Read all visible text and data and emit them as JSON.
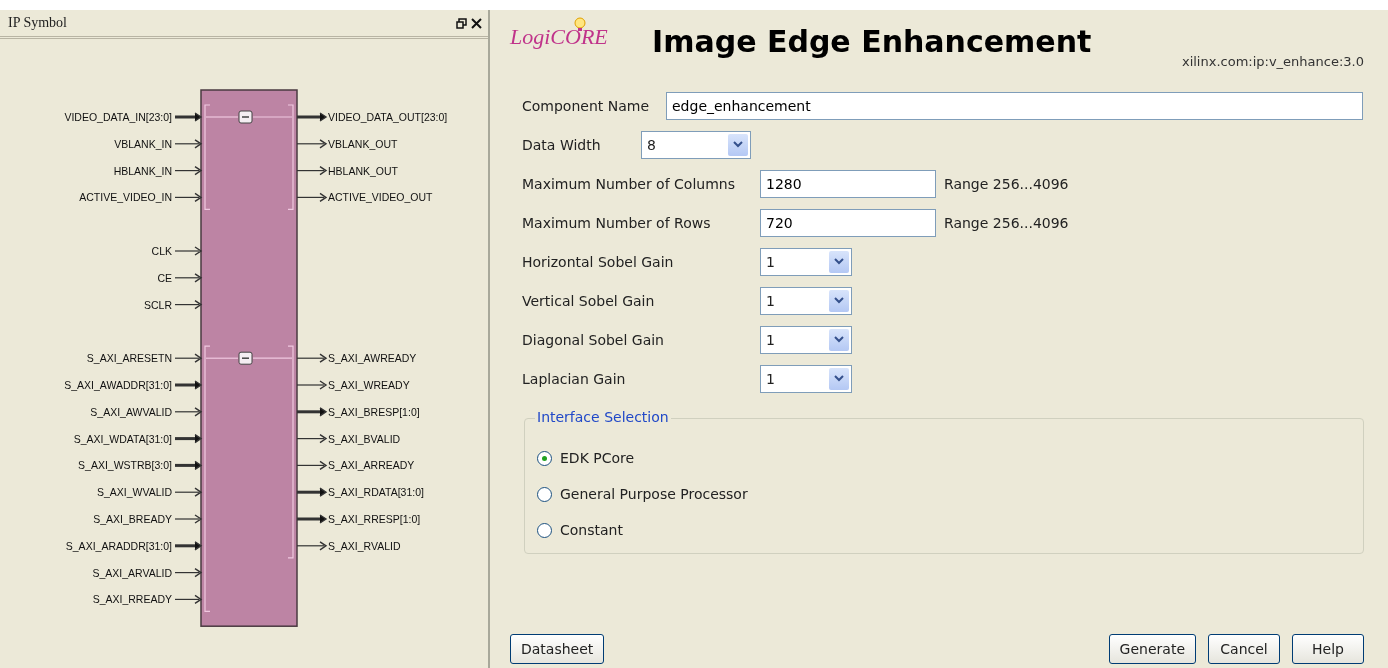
{
  "symbol_panel": {
    "title": "IP Symbol",
    "groups": [
      {
        "collapsible": true,
        "inputs": [
          {
            "name": "VIDEO_DATA_IN[23:0]",
            "bus": true
          },
          {
            "name": "VBLANK_IN",
            "bus": false
          },
          {
            "name": "HBLANK_IN",
            "bus": false
          },
          {
            "name": "ACTIVE_VIDEO_IN",
            "bus": false
          }
        ],
        "outputs": [
          {
            "name": "VIDEO_DATA_OUT[23:0]",
            "bus": true
          },
          {
            "name": "VBLANK_OUT",
            "bus": false
          },
          {
            "name": "HBLANK_OUT",
            "bus": false
          },
          {
            "name": "ACTIVE_VIDEO_OUT",
            "bus": false
          }
        ]
      },
      {
        "collapsible": false,
        "inputs": [
          {
            "name": "CLK",
            "bus": false
          },
          {
            "name": "CE",
            "bus": false
          },
          {
            "name": "SCLR",
            "bus": false
          }
        ]
      },
      {
        "collapsible": true,
        "inputs": [
          {
            "name": "S_AXI_ARESETN",
            "bus": false
          },
          {
            "name": "S_AXI_AWADDR[31:0]",
            "bus": true
          },
          {
            "name": "S_AXI_AWVALID",
            "bus": false
          },
          {
            "name": "S_AXI_WDATA[31:0]",
            "bus": true
          },
          {
            "name": "S_AXI_WSTRB[3:0]",
            "bus": true
          },
          {
            "name": "S_AXI_WVALID",
            "bus": false
          },
          {
            "name": "S_AXI_BREADY",
            "bus": false
          },
          {
            "name": "S_AXI_ARADDR[31:0]",
            "bus": true
          },
          {
            "name": "S_AXI_ARVALID",
            "bus": false
          },
          {
            "name": "S_AXI_RREADY",
            "bus": false
          }
        ],
        "outputs": [
          {
            "name": "S_AXI_AWREADY",
            "bus": false
          },
          {
            "name": "S_AXI_WREADY",
            "bus": false
          },
          {
            "name": "S_AXI_BRESP[1:0]",
            "bus": true
          },
          {
            "name": "S_AXI_BVALID",
            "bus": false
          },
          {
            "name": "S_AXI_ARREADY",
            "bus": false
          },
          {
            "name": "S_AXI_RDATA[31:0]",
            "bus": true
          },
          {
            "name": "S_AXI_RRESP[1:0]",
            "bus": true
          },
          {
            "name": "S_AXI_RVALID",
            "bus": false
          }
        ]
      }
    ]
  },
  "header": {
    "logo": "LogiCORE",
    "title": "Image Edge Enhancement",
    "version": "xilinx.com:ip:v_enhance:3.0"
  },
  "component_name": {
    "label": "Component Name",
    "value": "edge_enhancement"
  },
  "fields": [
    {
      "kind": "combo",
      "label": "Data Width",
      "value": "8"
    },
    {
      "kind": "text",
      "label": "Maximum Number of Columns",
      "value": "1280",
      "range": "Range 256...4096"
    },
    {
      "kind": "text",
      "label": "Maximum Number of Rows",
      "value": "720",
      "range": "Range 256...4096"
    },
    {
      "kind": "combo",
      "label": "Horizontal Sobel Gain",
      "value": "1"
    },
    {
      "kind": "combo",
      "label": "Vertical Sobel Gain",
      "value": "1"
    },
    {
      "kind": "combo",
      "label": "Diagonal Sobel Gain",
      "value": "1"
    },
    {
      "kind": "combo",
      "label": "Laplacian Gain",
      "value": "1"
    }
  ],
  "interface_selection": {
    "title": "Interface Selection",
    "options": [
      {
        "label": "EDK PCore",
        "selected": true
      },
      {
        "label": "General Purpose Processor",
        "selected": false
      },
      {
        "label": "Constant",
        "selected": false
      }
    ]
  },
  "buttons_left": [
    "Datasheet"
  ],
  "buttons_right": [
    "Generate",
    "Cancel",
    "Help"
  ]
}
